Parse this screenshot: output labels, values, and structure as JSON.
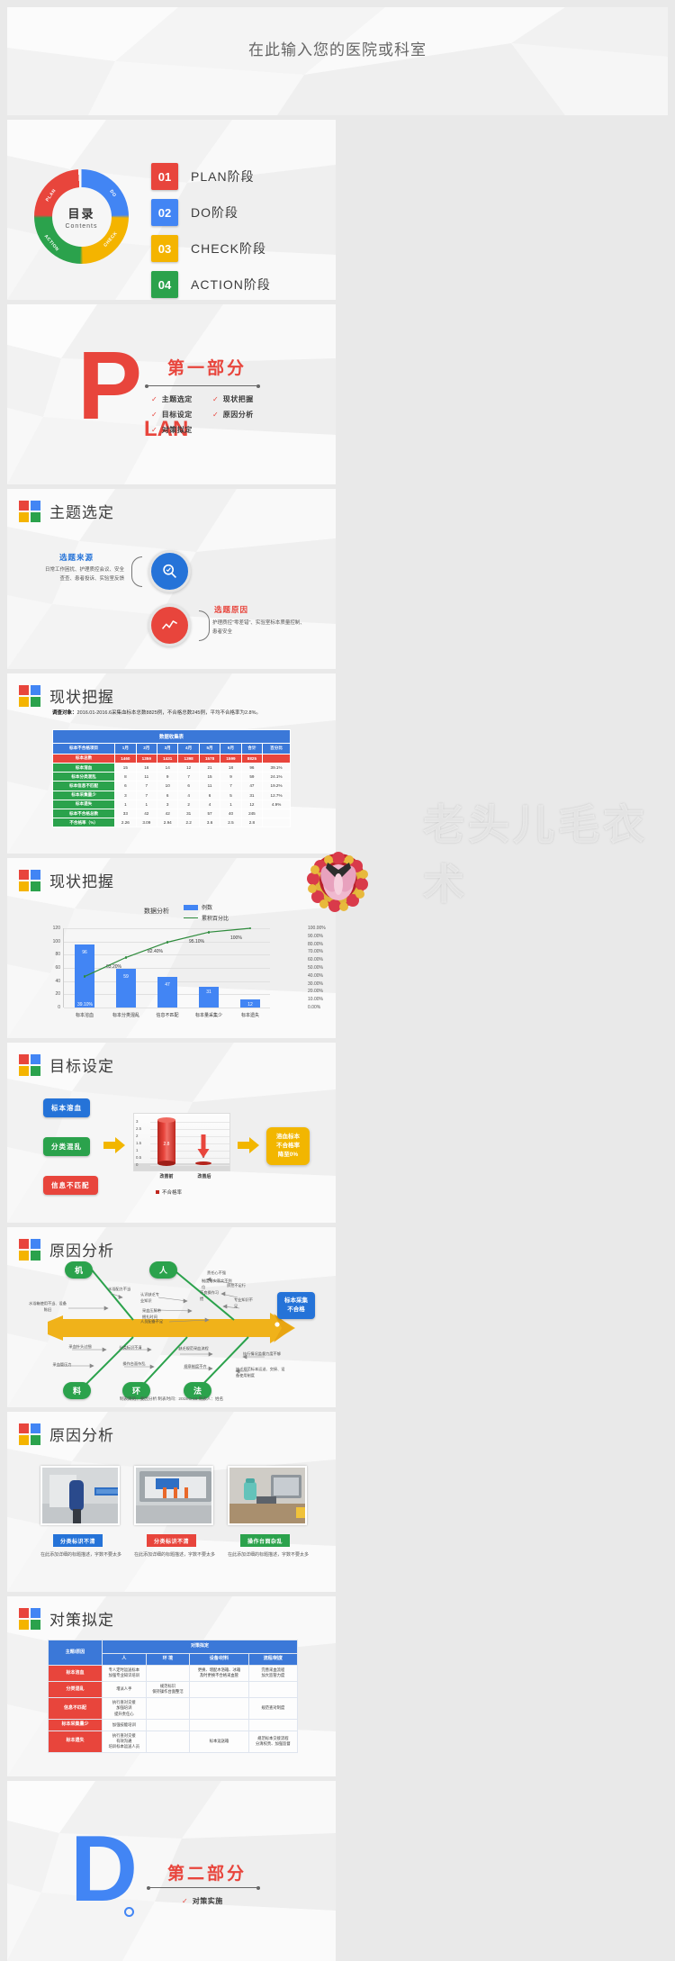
{
  "hero": {
    "title": "在此输入您的医院或科室"
  },
  "slide_contents": {
    "donut": {
      "center_title": "目录",
      "center_sub": "Contents",
      "ring_labels": [
        "PLAN",
        "DO",
        "CHECK",
        "ACTION"
      ]
    },
    "steps": [
      {
        "num": "01",
        "label": "PLAN阶段",
        "color": "#e8453c"
      },
      {
        "num": "02",
        "label": "DO阶段",
        "color": "#4285f4"
      },
      {
        "num": "03",
        "label": "CHECK阶段",
        "color": "#f4b400"
      },
      {
        "num": "04",
        "label": "ACTION阶段",
        "color": "#2ba24c"
      }
    ]
  },
  "slide_plan": {
    "letter": "P",
    "letter_rest": "LAN",
    "part_title": "第一部分",
    "items": [
      "主题选定",
      "现状把握",
      "目标设定",
      "原因分析",
      "对策拟定"
    ],
    "check": "✓"
  },
  "slide_topic": {
    "title": "主题选定",
    "source_head": "选题来源",
    "source_body": "日常工作困扰、护理质控会议、安全查查、患者投诉、实验室反馈",
    "reason_head": "选题原因",
    "reason_body": "护理质控\"零差错\"、实验室标本质量控制、患者安全",
    "icon_search": "search-icon",
    "icon_trend": "trend-icon"
  },
  "slide_status_table": {
    "title": "现状把握",
    "note_label": "调查对象：",
    "note_text": "2016.01-2016.6采集血标本总数8825例，不合格总数245例，平均不合格率为2.8%。",
    "table_title": "数据收集表",
    "headers": [
      "标本不合格项目",
      "1月",
      "2月",
      "3月",
      "4月",
      "5月",
      "6月",
      "合计",
      "百分比"
    ],
    "rows": [
      {
        "type": "red",
        "cells": [
          "标本总数",
          "1460",
          "1359",
          "1431",
          "1398",
          "1578",
          "1599",
          "8825",
          ""
        ]
      },
      {
        "type": "green",
        "cells": [
          "标本溶血",
          "15",
          "16",
          "14",
          "12",
          "21",
          "18",
          "96",
          "39.1%"
        ]
      },
      {
        "type": "green",
        "cells": [
          "标本分类混乱",
          "8",
          "11",
          "9",
          "7",
          "15",
          "9",
          "59",
          "24.1%"
        ]
      },
      {
        "type": "green",
        "cells": [
          "标本信息不匹配",
          "6",
          "7",
          "10",
          "6",
          "11",
          "7",
          "47",
          "19.2%"
        ]
      },
      {
        "type": "green",
        "cells": [
          "标本采集量少",
          "3",
          "7",
          "6",
          "4",
          "6",
          "5",
          "31",
          "12.7%"
        ]
      },
      {
        "type": "green",
        "cells": [
          "标本遗失",
          "1",
          "1",
          "3",
          "2",
          "4",
          "1",
          "12",
          "4.9%"
        ]
      },
      {
        "type": "green",
        "cells": [
          "标本不合格总数",
          "33",
          "42",
          "42",
          "31",
          "57",
          "40",
          "245",
          ""
        ]
      },
      {
        "type": "green",
        "cells": [
          "不合格率（%）",
          "2.26",
          "3.09",
          "2.94",
          "2.2",
          "3.6",
          "2.5",
          "2.8",
          ""
        ]
      }
    ]
  },
  "slide_pareto": {
    "title": "现状把握",
    "chart_data": {
      "type": "bar",
      "title": "数据分析",
      "categories": [
        "标本溶血",
        "标本分类混乱",
        "信息不匹配",
        "标本量采集少",
        "标本遗失"
      ],
      "series": [
        {
          "name": "例数",
          "type": "bar",
          "color": "#4285f4",
          "values": [
            96,
            59,
            47,
            31,
            12
          ]
        },
        {
          "name": "累积百分比",
          "type": "line",
          "color": "#2e8b3c",
          "values": [
            39.1,
            63.2,
            82.4,
            95.1,
            100.0
          ],
          "labels": [
            "39.10%",
            "63.20%",
            "82.40%",
            "95.10%",
            "100%"
          ]
        }
      ],
      "ylim": [
        0,
        120
      ],
      "yticks": [
        "0",
        "20",
        "40",
        "60",
        "80",
        "100",
        "120"
      ],
      "y2lim": [
        0,
        100
      ],
      "y2ticks": [
        "0.00%",
        "10.00%",
        "20.00%",
        "30.00%",
        "40.00%",
        "50.00%",
        "60.00%",
        "70.00%",
        "80.00%",
        "90.00%",
        "100.00%"
      ],
      "legend": [
        "例数",
        "累积百分比"
      ],
      "grid": true,
      "xlabel": "",
      "ylabel": ""
    }
  },
  "slide_goal": {
    "title": "目标设定",
    "tags": [
      {
        "label": "标本溶血",
        "color": "#2573d8"
      },
      {
        "label": "分类混乱",
        "color": "#2ba24c"
      },
      {
        "label": "信息不匹配",
        "color": "#e8453c"
      }
    ],
    "goal_box": "溶血标本\n不合格率\n降至0%",
    "goal_lines": [
      "溶血标本",
      "不合格率",
      "降至0%"
    ],
    "chart_data": {
      "type": "bar",
      "title": "",
      "categories": [
        "改善前",
        "改善后"
      ],
      "values": [
        2.8,
        0
      ],
      "labels": [
        "2.8",
        "0"
      ],
      "legend": [
        "不合格率"
      ],
      "ylim": [
        0,
        3
      ],
      "yticks": [
        "0",
        "0.5",
        "1",
        "1.5",
        "2",
        "2.5",
        "3"
      ],
      "color": "#c0281f"
    }
  },
  "slide_fishbone": {
    "title": "原因分析",
    "head_box": "标本采集\n不合格",
    "head_lines": [
      "标本采集",
      "不合格"
    ],
    "nodes_top": [
      "机",
      "人"
    ],
    "nodes_bottom": [
      "料",
      "环",
      "法"
    ],
    "branch_texts": {
      "machine": [
        "水浴箱使用不当、设备陈旧",
        "水浴配方不当"
      ],
      "people": [
        "责任心不强",
        "制度落实落实不到位",
        "不良操作习惯",
        "认识缺乏专业知识",
        "质控不足行",
        "专业知识不足",
        "采血压脉带捆扎时间",
        "人员配备不足"
      ],
      "material": [
        "采血针头过细",
        "采血管压力"
      ],
      "env": [
        "分类标识不清",
        "操作台面杂乱"
      ],
      "method": [
        "缺乏规范采血流程",
        "规章制度不齐"
      ],
      "method2": [
        "执行情况监督力度不够",
        "缺乏规范标本运送、交接、设备使用制度"
      ]
    },
    "caption": "制表目的：要因分析   制表时间：2018-8-18   制表人：姓名"
  },
  "slide_photos": {
    "title": "原因分析",
    "photos": [
      {
        "badge": "分类标识不清",
        "badge_color": "#2573d8",
        "caption": "在此添加详细的标题描述，字数不要太多"
      },
      {
        "badge": "分类标识不清",
        "badge_color": "#e8453c",
        "caption": "在此添加详细的标题描述，字数不要太多"
      },
      {
        "badge": "操作台面杂乱",
        "badge_color": "#2ba24c",
        "caption": "在此添加详细的标题描述，字数不要太多"
      }
    ]
  },
  "slide_counter": {
    "title": "对策拟定",
    "corner_header": "主题/原因",
    "group_header": "对策拟定",
    "sub_headers": [
      "人",
      "环   境",
      "设备/材料",
      "流程/制度"
    ],
    "rows": [
      {
        "cause": "标本溶血",
        "cells": [
          "专人定时运送标本\n加强专业知识培训",
          "",
          "更换、增配木浴箱、冰箱\n及时更换不合格采血管",
          "完善采血流程\n加大监管力度"
        ]
      },
      {
        "cause": "分类混乱",
        "cells": [
          "增派人手",
          "规范标识\n保持操作台面整洁",
          "",
          ""
        ]
      },
      {
        "cause": "信息不匹配",
        "cells": [
          "执行查对交接\n加强培训\n提升责任心",
          "",
          "",
          "规范查对制度"
        ]
      },
      {
        "cause": "标本采集量少",
        "cells": [
          "加强技能培训",
          "",
          "",
          ""
        ]
      },
      {
        "cause": "标本遗失",
        "cells": [
          "执行查对交接\n有效沟通\n培训标本运送人员",
          "",
          "标本运送箱",
          "规范标本交接流程\n分清权责、加强监督"
        ]
      }
    ]
  },
  "slide_do": {
    "letter": "D",
    "part_title": "第二部分",
    "items": [
      "对策实施"
    ],
    "check": "✓"
  },
  "watermark": {
    "text": "老头儿毛衣术",
    "flower": "flower-wreath-icon"
  },
  "colors": {
    "red": "#e8453c",
    "blue": "#4285f4",
    "yellow": "#f4b400",
    "green": "#2ba24c",
    "table_blue": "#3b78d8",
    "line_green": "#2e8b3c"
  }
}
